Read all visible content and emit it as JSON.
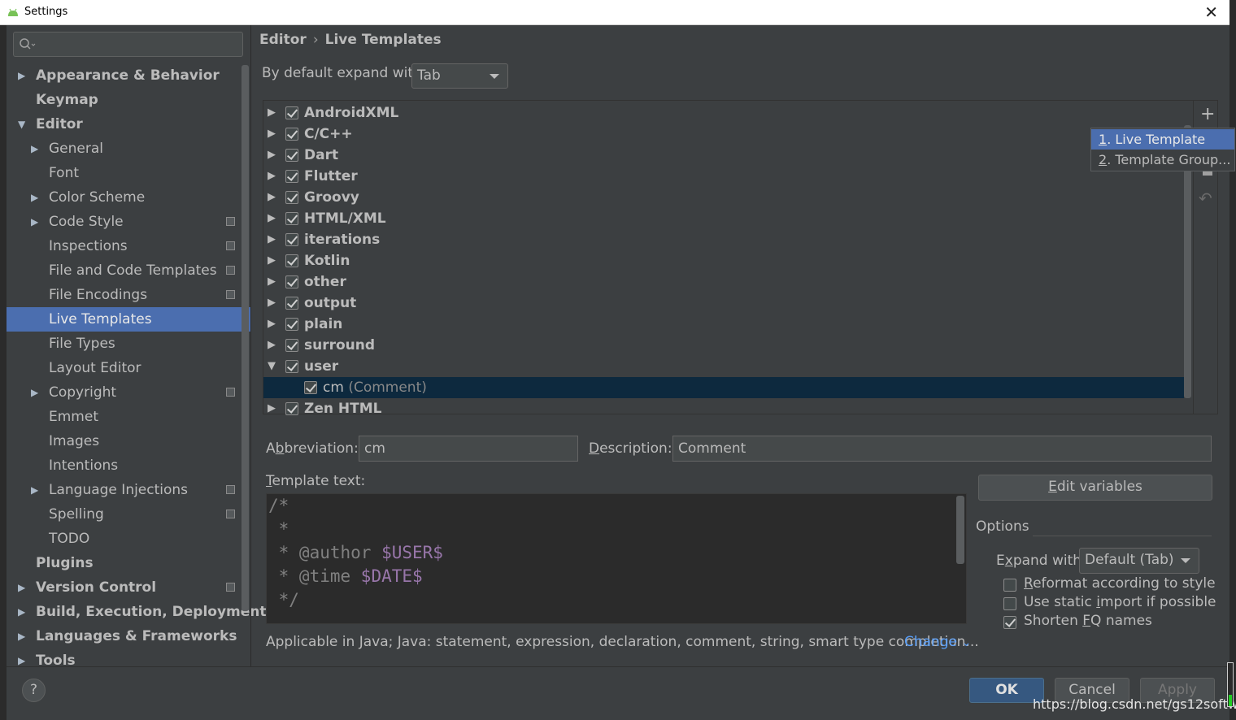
{
  "window": {
    "title": "Settings",
    "close_glyph": "✕"
  },
  "sidebar": {
    "search_placeholder": "",
    "items": [
      {
        "label": "Appearance & Behavior",
        "bold": true,
        "arrow": "▶",
        "level": 0,
        "proj": false
      },
      {
        "label": "Keymap",
        "bold": true,
        "arrow": "",
        "level": 0,
        "proj": false
      },
      {
        "label": "Editor",
        "bold": true,
        "arrow": "▼",
        "level": 0,
        "proj": false
      },
      {
        "label": "General",
        "bold": false,
        "arrow": "▶",
        "level": 1,
        "proj": false
      },
      {
        "label": "Font",
        "bold": false,
        "arrow": "",
        "level": 1,
        "proj": false
      },
      {
        "label": "Color Scheme",
        "bold": false,
        "arrow": "▶",
        "level": 1,
        "proj": false
      },
      {
        "label": "Code Style",
        "bold": false,
        "arrow": "▶",
        "level": 1,
        "proj": true
      },
      {
        "label": "Inspections",
        "bold": false,
        "arrow": "",
        "level": 1,
        "proj": true
      },
      {
        "label": "File and Code Templates",
        "bold": false,
        "arrow": "",
        "level": 1,
        "proj": true
      },
      {
        "label": "File Encodings",
        "bold": false,
        "arrow": "",
        "level": 1,
        "proj": true
      },
      {
        "label": "Live Templates",
        "bold": false,
        "arrow": "",
        "level": 1,
        "proj": false,
        "selected": true
      },
      {
        "label": "File Types",
        "bold": false,
        "arrow": "",
        "level": 1,
        "proj": false
      },
      {
        "label": "Layout Editor",
        "bold": false,
        "arrow": "",
        "level": 1,
        "proj": false
      },
      {
        "label": "Copyright",
        "bold": false,
        "arrow": "▶",
        "level": 1,
        "proj": true
      },
      {
        "label": "Emmet",
        "bold": false,
        "arrow": "",
        "level": 1,
        "proj": false
      },
      {
        "label": "Images",
        "bold": false,
        "arrow": "",
        "level": 1,
        "proj": false
      },
      {
        "label": "Intentions",
        "bold": false,
        "arrow": "",
        "level": 1,
        "proj": false
      },
      {
        "label": "Language Injections",
        "bold": false,
        "arrow": "▶",
        "level": 1,
        "proj": true
      },
      {
        "label": "Spelling",
        "bold": false,
        "arrow": "",
        "level": 1,
        "proj": true
      },
      {
        "label": "TODO",
        "bold": false,
        "arrow": "",
        "level": 1,
        "proj": false
      },
      {
        "label": "Plugins",
        "bold": true,
        "arrow": "",
        "level": 0,
        "proj": false
      },
      {
        "label": "Version Control",
        "bold": true,
        "arrow": "▶",
        "level": 0,
        "proj": true
      },
      {
        "label": "Build, Execution, Deployment",
        "bold": true,
        "arrow": "▶",
        "level": 0,
        "proj": false
      },
      {
        "label": "Languages & Frameworks",
        "bold": true,
        "arrow": "▶",
        "level": 0,
        "proj": false
      },
      {
        "label": "Tools",
        "bold": true,
        "arrow": "▶",
        "level": 0,
        "proj": false
      }
    ]
  },
  "breadcrumb": {
    "parent": "Editor",
    "separator": "›",
    "current": "Live Templates"
  },
  "expand_default": {
    "label": "By default expand with",
    "value": "Tab"
  },
  "tree": {
    "groups": [
      {
        "name": "AndroidXML",
        "checked": true,
        "arrow": "▶"
      },
      {
        "name": "C/C++",
        "checked": true,
        "arrow": "▶"
      },
      {
        "name": "Dart",
        "checked": true,
        "arrow": "▶"
      },
      {
        "name": "Flutter",
        "checked": true,
        "arrow": "▶"
      },
      {
        "name": "Groovy",
        "checked": true,
        "arrow": "▶"
      },
      {
        "name": "HTML/XML",
        "checked": true,
        "arrow": "▶"
      },
      {
        "name": "iterations",
        "checked": true,
        "arrow": "▶"
      },
      {
        "name": "Kotlin",
        "checked": true,
        "arrow": "▶"
      },
      {
        "name": "other",
        "checked": true,
        "arrow": "▶"
      },
      {
        "name": "output",
        "checked": true,
        "arrow": "▶"
      },
      {
        "name": "plain",
        "checked": true,
        "arrow": "▶"
      },
      {
        "name": "surround",
        "checked": true,
        "arrow": "▶"
      },
      {
        "name": "user",
        "checked": true,
        "arrow": "▼"
      },
      {
        "name": "cm",
        "desc": "(Comment)",
        "checked": true,
        "arrow": "",
        "child": true,
        "selected": true
      },
      {
        "name": "Zen HTML",
        "checked": true,
        "arrow": "▶"
      }
    ]
  },
  "toolbar": {
    "add_glyph": "+",
    "undo_glyph": "↶"
  },
  "add_menu": {
    "items": [
      {
        "num": "1",
        "label": ". Live Template"
      },
      {
        "num": "2",
        "label": ". Template Group..."
      }
    ]
  },
  "abbreviation": {
    "label_pre": "A",
    "label_mn": "b",
    "label_post": "breviation:",
    "value": "cm"
  },
  "description": {
    "label_mn": "D",
    "label_post": "escription:",
    "value": "Comment"
  },
  "template_text": {
    "label_mn": "T",
    "label_post": "emplate text:",
    "lines": [
      {
        "plain": "/*",
        "var": ""
      },
      {
        "plain": " *",
        "var": ""
      },
      {
        "plain": " * @author ",
        "var": "$USER$"
      },
      {
        "plain": " * @time ",
        "var": "$DATE$"
      },
      {
        "plain": " */",
        "var": ""
      }
    ]
  },
  "edit_variables": {
    "mn": "E",
    "post": "dit variables"
  },
  "options": {
    "title": "Options",
    "expand_with": {
      "pre": "E",
      "mn": "x",
      "post": "pand with",
      "value": "Default (Tab)"
    },
    "checks": [
      {
        "pre": "",
        "mn": "R",
        "post": "eformat according to style",
        "checked": false
      },
      {
        "pre": "Use static ",
        "mn": "i",
        "post": "mport if possible",
        "checked": false
      },
      {
        "pre": "Shorten ",
        "mn": "F",
        "post": "Q names",
        "checked": true
      }
    ]
  },
  "applicable": {
    "text": "Applicable in Java; Java: statement, expression, declaration, comment, string, smart type completion...",
    "link": "Change",
    "chevron": "⌄"
  },
  "buttons": {
    "help": "?",
    "ok": "OK",
    "cancel": "Cancel",
    "apply": "Apply"
  },
  "watermark": "https://blog.csdn.net/gs12software"
}
